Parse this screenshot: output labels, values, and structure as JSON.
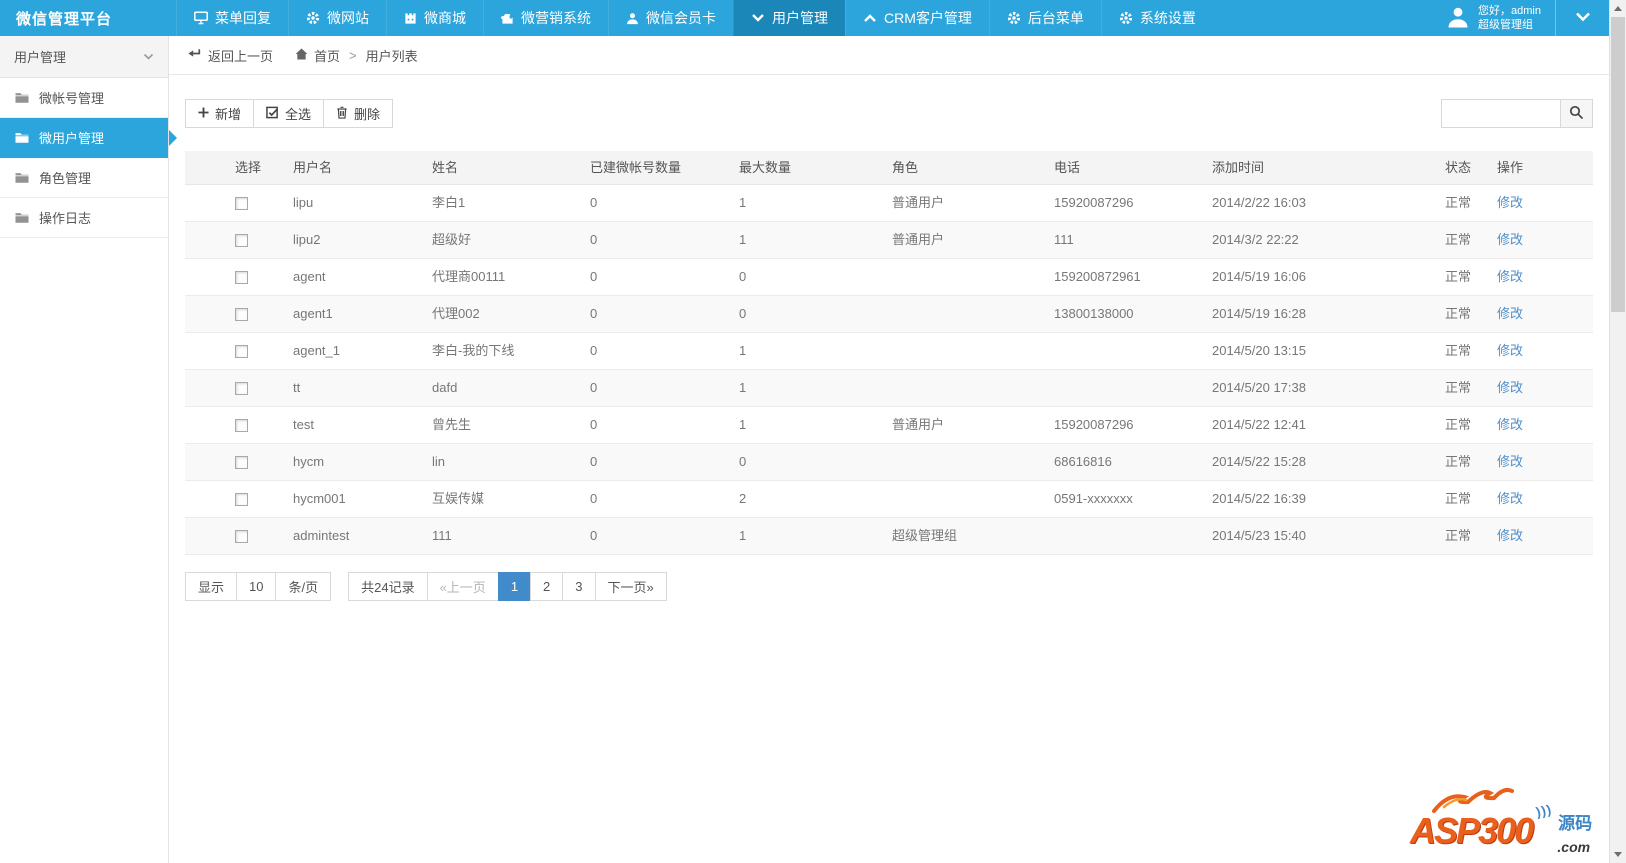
{
  "brand": "微信管理平台",
  "topnav": {
    "items": [
      {
        "label": "菜单回复",
        "icon": "monitor-icon",
        "active": false
      },
      {
        "label": "微网站",
        "icon": "gear-icon",
        "active": false
      },
      {
        "label": "微商城",
        "icon": "shop-icon",
        "active": false
      },
      {
        "label": "微营销系统",
        "icon": "puzzle-icon",
        "active": false
      },
      {
        "label": "微信会员卡",
        "icon": "person-icon",
        "active": false
      },
      {
        "label": "用户管理",
        "icon": "chevron-down-icon",
        "active": true
      },
      {
        "label": "CRM客户管理",
        "icon": "chevron-up-icon",
        "active": false
      },
      {
        "label": "后台菜单",
        "icon": "gear-icon",
        "active": false
      },
      {
        "label": "系统设置",
        "icon": "gear-icon",
        "active": false
      }
    ],
    "user": {
      "greeting": "您好，admin",
      "role": "超级管理组"
    }
  },
  "sidebar": {
    "header": "用户管理",
    "items": [
      {
        "label": "微帐号管理",
        "active": false
      },
      {
        "label": "微用户管理",
        "active": true
      },
      {
        "label": "角色管理",
        "active": false
      },
      {
        "label": "操作日志",
        "active": false
      }
    ]
  },
  "breadcrumb": {
    "back": "返回上一页",
    "home": "首页",
    "separator": ">",
    "current": "用户列表"
  },
  "toolbar": {
    "add_label": "新增",
    "select_all_label": "全选",
    "delete_label": "删除"
  },
  "search": {
    "value": ""
  },
  "table": {
    "columns": [
      "选择",
      "用户名",
      "姓名",
      "已建微帐号数量",
      "最大数量",
      "角色",
      "电话",
      "添加时间",
      "状态",
      "操作"
    ],
    "rows": [
      {
        "username": "lipu",
        "name": "李白1",
        "created": "0",
        "max": "1",
        "role": "普通用户",
        "phone": "15920087296",
        "added": "2014/2/22 16:03",
        "status": "正常",
        "action": "修改"
      },
      {
        "username": "lipu2",
        "name": "超级好",
        "created": "0",
        "max": "1",
        "role": "普通用户",
        "phone": "111",
        "added": "2014/3/2 22:22",
        "status": "正常",
        "action": "修改"
      },
      {
        "username": "agent",
        "name": "代理商00111",
        "created": "0",
        "max": "0",
        "role": "",
        "phone": "159200872961",
        "added": "2014/5/19 16:06",
        "status": "正常",
        "action": "修改"
      },
      {
        "username": "agent1",
        "name": "代理002",
        "created": "0",
        "max": "0",
        "role": "",
        "phone": "13800138000",
        "added": "2014/5/19 16:28",
        "status": "正常",
        "action": "修改"
      },
      {
        "username": "agent_1",
        "name": "李白-我的下线",
        "created": "0",
        "max": "1",
        "role": "",
        "phone": "",
        "added": "2014/5/20 13:15",
        "status": "正常",
        "action": "修改"
      },
      {
        "username": "tt",
        "name": "dafd",
        "created": "0",
        "max": "1",
        "role": "",
        "phone": "",
        "added": "2014/5/20 17:38",
        "status": "正常",
        "action": "修改"
      },
      {
        "username": "test",
        "name": "曾先生",
        "created": "0",
        "max": "1",
        "role": "普通用户",
        "phone": "15920087296",
        "added": "2014/5/22 12:41",
        "status": "正常",
        "action": "修改"
      },
      {
        "username": "hycm",
        "name": "lin",
        "created": "0",
        "max": "0",
        "role": "",
        "phone": "68616816",
        "added": "2014/5/22 15:28",
        "status": "正常",
        "action": "修改"
      },
      {
        "username": "hycm001",
        "name": "互娱传媒",
        "created": "0",
        "max": "2",
        "role": "",
        "phone": "0591-xxxxxxx",
        "added": "2014/5/22 16:39",
        "status": "正常",
        "action": "修改"
      },
      {
        "username": "admintest",
        "name": "111",
        "created": "0",
        "max": "1",
        "role": "超级管理组",
        "phone": "",
        "added": "2014/5/23 15:40",
        "status": "正常",
        "action": "修改"
      }
    ]
  },
  "pagination": {
    "show_label": "显示",
    "page_size": "10",
    "per_page_label": "条/页",
    "total_label": "共24记录",
    "prev_label": "«上一页",
    "pages": [
      "1",
      "2",
      "3"
    ],
    "active_page": "1",
    "next_label": "下一页»"
  },
  "watermark": {
    "main": "ASP300",
    "tag": "源码",
    "suffix": ".com"
  },
  "colors": {
    "topbar": "#2CA5DC",
    "topbar_active": "#1B86B8",
    "pagination_active": "#428BCA",
    "link": "#4E8FCB"
  }
}
